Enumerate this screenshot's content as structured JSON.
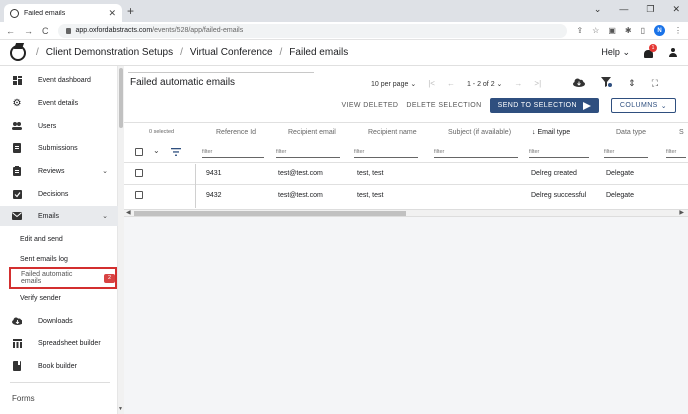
{
  "browser": {
    "tab_title": "Failed emails",
    "url_host": "app.oxfordabstracts.com",
    "url_path": "/events/528/app/failed-emails",
    "profile_initial": "N"
  },
  "header": {
    "breadcrumbs": [
      "Client Demonstration Setups",
      "Virtual Conference",
      "Failed emails"
    ],
    "help_label": "Help",
    "notification_count": "1"
  },
  "sidebar": {
    "items": [
      {
        "label": "Event dashboard",
        "icon": "dashboard-icon"
      },
      {
        "label": "Event details",
        "icon": "gear-icon"
      },
      {
        "label": "Users",
        "icon": "users-icon"
      },
      {
        "label": "Submissions",
        "icon": "document-icon"
      },
      {
        "label": "Reviews",
        "icon": "reviews-icon"
      },
      {
        "label": "Decisions",
        "icon": "checkbox-icon"
      },
      {
        "label": "Emails",
        "icon": "mail-icon"
      }
    ],
    "email_subitems": [
      {
        "label": "Edit and send"
      },
      {
        "label": "Sent emails log"
      },
      {
        "label": "Failed automatic emails",
        "count": "2"
      },
      {
        "label": "Verify sender"
      }
    ],
    "more_items": [
      {
        "label": "Downloads",
        "icon": "cloud-download-icon"
      },
      {
        "label": "Spreadsheet builder",
        "icon": "table-icon"
      },
      {
        "label": "Book builder",
        "icon": "book-icon"
      }
    ],
    "section_label": "Forms"
  },
  "main": {
    "title": "Failed automatic emails",
    "per_page": "10 per page",
    "page_range": "1 - 2 of 2",
    "actions": {
      "view_deleted": "VIEW DELETED",
      "delete_selection": "DELETE SELECTION",
      "send_to_selection": "SEND TO SELECTION",
      "columns": "COLUMNS"
    },
    "table": {
      "selected_label": "0 selected",
      "columns": [
        "Reference Id",
        "Recipient email",
        "Recipient name",
        "Subject (if available)",
        "Email type",
        "Data type",
        "S"
      ],
      "filter_placeholder": "filter",
      "rows": [
        {
          "ref": "9431",
          "email": "test@test.com",
          "name": "test, test",
          "subject": "",
          "email_type": "Delreg created",
          "data_type": "Delegate"
        },
        {
          "ref": "9432",
          "email": "test@test.com",
          "name": "test, test",
          "subject": "",
          "email_type": "Delreg successful",
          "data_type": "Delegate"
        }
      ]
    }
  },
  "colors": {
    "primary": "#2f4f7f",
    "highlight_border": "#d32f2f",
    "badge": "#d84343"
  }
}
